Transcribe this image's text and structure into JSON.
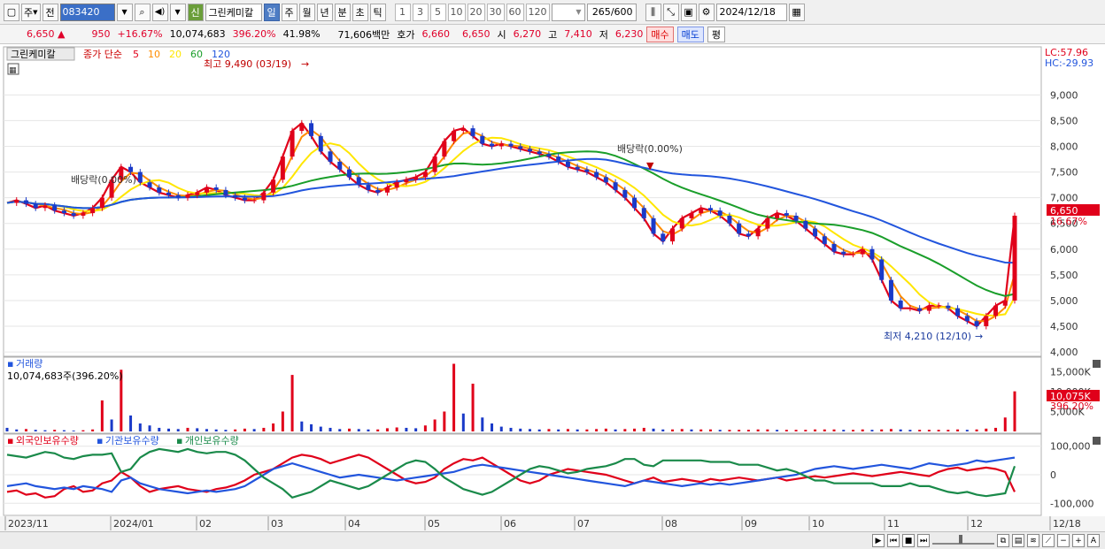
{
  "toolbar": {
    "market_label": "주",
    "prev_label": "전",
    "code": "083420",
    "new_badge": "신",
    "stock_name": "그린케미칼",
    "periods": [
      "일",
      "주",
      "월",
      "년",
      "분",
      "초",
      "틱"
    ],
    "selected_period": "일",
    "intervals": [
      "1",
      "3",
      "5",
      "10",
      "20",
      "30",
      "60",
      "120"
    ],
    "count_shown": "265",
    "count_total": "/600",
    "date": "2024/12/18"
  },
  "quote": {
    "price": "6,650",
    "change": "950",
    "change_pct": "+16.67%",
    "volume": "10,074,683",
    "volume_ratio": "396.20%",
    "turnover": "41.98%",
    "amount": "71,606백만",
    "bid_label": "호가",
    "bid": "6,660",
    "ask": "6,650",
    "open_label": "시",
    "open": "6,270",
    "high_label": "고",
    "high": "7,410",
    "low_label": "저",
    "low": "6,230",
    "buy_label": "매수",
    "sell_label": "매도",
    "avg_label": "평"
  },
  "chart_data": [
    {
      "type": "candlestick",
      "legend_name": "그린케미칼",
      "ma_label": "종가 단순",
      "ma_periods": [
        "5",
        "10",
        "20",
        "60",
        "120"
      ],
      "ma_colors": [
        "#e0001a",
        "#ff8c00",
        "#ffe600",
        "#1a9e2a",
        "#2255dd"
      ],
      "lc_label": "LC:57.96",
      "hc_label": "HC:-29.93",
      "y_ticks": [
        "9,000",
        "8,500",
        "8,000",
        "7,500",
        "7,000",
        "6,500",
        "6,000",
        "5,500",
        "5,000",
        "4,500",
        "4,000"
      ],
      "ylim": [
        3950,
        9900
      ],
      "last_price_tag": "6,650",
      "last_pct_tag": "16.67%",
      "high_annotation": "최고 9,490 (03/19)",
      "low_annotation": "최저 4,210 (12/10)",
      "dividend_annotation": "배당락(0.00%)",
      "dividend_annotation_2": "배당락(0.00%)",
      "x_ticks": [
        "2023/11",
        "2024/01",
        "02",
        "03",
        "04",
        "05",
        "06",
        "07",
        "08",
        "09",
        "10",
        "11",
        "12",
        "12/18"
      ],
      "close_series": [
        6900,
        6950,
        6880,
        6800,
        6850,
        6750,
        6700,
        6650,
        6700,
        6800,
        7000,
        7350,
        7600,
        7500,
        7300,
        7200,
        7100,
        7050,
        7000,
        7050,
        7100,
        7200,
        7150,
        7050,
        7000,
        6950,
        6950,
        7100,
        7350,
        7800,
        8300,
        8450,
        8200,
        7900,
        7700,
        7550,
        7400,
        7250,
        7150,
        7100,
        7200,
        7300,
        7350,
        7400,
        7500,
        7800,
        8100,
        8300,
        8350,
        8200,
        8050,
        8000,
        8050,
        8000,
        7950,
        7900,
        7850,
        7800,
        7700,
        7600,
        7550,
        7500,
        7400,
        7300,
        7150,
        7000,
        6800,
        6600,
        6300,
        6150,
        6400,
        6600,
        6700,
        6800,
        6750,
        6650,
        6500,
        6300,
        6250,
        6400,
        6600,
        6700,
        6650,
        6550,
        6400,
        6250,
        6100,
        5950,
        5900,
        5900,
        6000,
        5800,
        5400,
        5000,
        4850,
        4850,
        4800,
        4900,
        4900,
        4850,
        4700,
        4600,
        4500,
        4700,
        4900,
        5000,
        6650
      ]
    },
    {
      "type": "bar",
      "legend_name": "거래량",
      "info": "10,074,683주(396.20%)",
      "y_ticks": [
        "15,000K",
        "10,000K",
        "5,000K"
      ],
      "last_tag": "10,075K",
      "last_pct_tag": "396.20%",
      "values_k": [
        900,
        500,
        600,
        400,
        300,
        400,
        300,
        200,
        300,
        500,
        7800,
        3000,
        15500,
        4000,
        2000,
        1500,
        900,
        700,
        600,
        900,
        800,
        600,
        500,
        400,
        500,
        700,
        600,
        900,
        2000,
        5000,
        14200,
        2500,
        1800,
        1200,
        900,
        600,
        700,
        600,
        500,
        500,
        800,
        1000,
        900,
        800,
        1500,
        3000,
        5000,
        17000,
        4500,
        12000,
        3500,
        2000,
        1200,
        900,
        700,
        600,
        500,
        600,
        500,
        600,
        500,
        500,
        600,
        700,
        500,
        600,
        700,
        900,
        700,
        500,
        500,
        600,
        500,
        500,
        500,
        400,
        400,
        400,
        400,
        500,
        500,
        400,
        400,
        400,
        400,
        500,
        500,
        500,
        400,
        400,
        500,
        400,
        500,
        600,
        500,
        400,
        400,
        400,
        400,
        400,
        500,
        400,
        500,
        700,
        900,
        3500,
        10075
      ]
    },
    {
      "type": "line",
      "legend_items": [
        "외국인보유수량",
        "기관보유수량",
        "개인보유수량"
      ],
      "series_colors": [
        "#e0001a",
        "#2255dd",
        "#1a8a4a"
      ],
      "y_ticks": [
        "100,000",
        "0",
        "-100,000"
      ],
      "foreign": [
        -60,
        -55,
        -70,
        -65,
        -80,
        -75,
        -50,
        -40,
        -60,
        -55,
        -30,
        -20,
        10,
        -10,
        -40,
        -60,
        -50,
        -45,
        -40,
        -50,
        -55,
        -60,
        -50,
        -45,
        -35,
        -20,
        0,
        10,
        20,
        40,
        60,
        70,
        65,
        55,
        40,
        50,
        60,
        70,
        60,
        40,
        20,
        0,
        -20,
        -30,
        -25,
        -10,
        20,
        40,
        55,
        50,
        60,
        40,
        20,
        0,
        -20,
        -30,
        -20,
        0,
        10,
        20,
        15,
        10,
        5,
        0,
        -10,
        -20,
        -30,
        -20,
        -10,
        -25,
        -20,
        -15,
        -20,
        -25,
        -15,
        -20,
        -15,
        -10,
        -15,
        -20,
        -15,
        -10,
        -20,
        -15,
        -10,
        -5,
        -10,
        -5,
        0,
        5,
        0,
        -5,
        0,
        5,
        10,
        5,
        0,
        -5,
        10,
        20,
        25,
        15,
        20,
        25,
        20,
        10,
        -60
      ],
      "institution": [
        -40,
        -35,
        -30,
        -40,
        -45,
        -50,
        -45,
        -50,
        -40,
        -45,
        -50,
        -60,
        -20,
        -10,
        -30,
        -40,
        -50,
        -55,
        -60,
        -65,
        -60,
        -55,
        -60,
        -55,
        -50,
        -40,
        -20,
        0,
        20,
        30,
        40,
        30,
        20,
        10,
        0,
        -10,
        -5,
        0,
        -5,
        -10,
        -15,
        -20,
        -15,
        -10,
        -5,
        0,
        5,
        10,
        20,
        30,
        35,
        30,
        25,
        20,
        15,
        10,
        5,
        0,
        -5,
        -10,
        -15,
        -20,
        -25,
        -30,
        -35,
        -40,
        -30,
        -20,
        -25,
        -30,
        -35,
        -40,
        -35,
        -30,
        -35,
        -30,
        -35,
        -30,
        -25,
        -20,
        -15,
        -10,
        -5,
        0,
        10,
        20,
        25,
        30,
        25,
        20,
        25,
        30,
        35,
        30,
        25,
        20,
        30,
        40,
        35,
        30,
        35,
        40,
        50,
        45,
        50,
        55,
        60
      ],
      "individual": [
        70,
        65,
        60,
        70,
        80,
        75,
        60,
        55,
        65,
        70,
        70,
        75,
        10,
        20,
        60,
        80,
        90,
        85,
        80,
        90,
        80,
        75,
        80,
        80,
        70,
        50,
        20,
        -10,
        -30,
        -50,
        -80,
        -70,
        -60,
        -40,
        -20,
        -30,
        -40,
        -50,
        -40,
        -20,
        0,
        20,
        40,
        50,
        45,
        20,
        -10,
        -30,
        -50,
        -60,
        -70,
        -60,
        -40,
        -20,
        0,
        20,
        30,
        25,
        15,
        5,
        10,
        20,
        25,
        30,
        40,
        55,
        55,
        35,
        30,
        50,
        50,
        50,
        50,
        50,
        45,
        45,
        45,
        35,
        35,
        35,
        25,
        15,
        20,
        10,
        -5,
        -20,
        -20,
        -30,
        -30,
        -30,
        -30,
        -30,
        -40,
        -40,
        -40,
        -30,
        -40,
        -40,
        -50,
        -60,
        -65,
        -60,
        -70,
        -75,
        -70,
        -65,
        30
      ]
    }
  ],
  "bottom_bar": {
    "zoom_minus": "−",
    "zoom_plus": "+",
    "font_a": "A"
  }
}
